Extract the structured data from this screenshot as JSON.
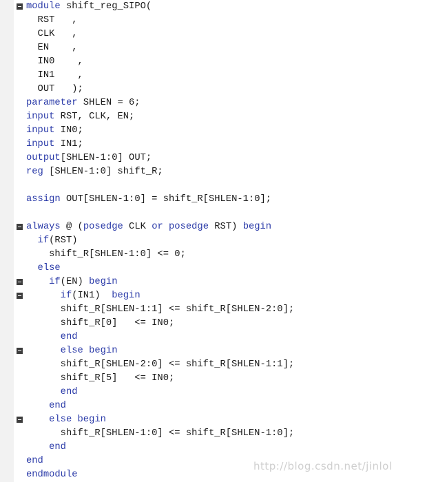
{
  "lines": [
    {
      "indent": 0,
      "segments": [
        {
          "text": "module",
          "kw": true
        },
        {
          "text": " shift_reg_SIPO("
        }
      ],
      "fold": true
    },
    {
      "indent": 2,
      "segments": [
        {
          "text": "RST   ,"
        }
      ]
    },
    {
      "indent": 2,
      "segments": [
        {
          "text": "CLK   ,"
        }
      ]
    },
    {
      "indent": 2,
      "segments": [
        {
          "text": "EN    ,"
        }
      ]
    },
    {
      "indent": 2,
      "segments": [
        {
          "text": "IN0    ,"
        }
      ]
    },
    {
      "indent": 2,
      "segments": [
        {
          "text": "IN1    ,"
        }
      ]
    },
    {
      "indent": 2,
      "segments": [
        {
          "text": "OUT   );"
        }
      ]
    },
    {
      "indent": 0,
      "segments": [
        {
          "text": "parameter",
          "kw": true
        },
        {
          "text": " SHLEN = 6;"
        }
      ]
    },
    {
      "indent": 0,
      "segments": [
        {
          "text": "input",
          "kw": true
        },
        {
          "text": " RST, CLK, EN;"
        }
      ]
    },
    {
      "indent": 0,
      "segments": [
        {
          "text": "input",
          "kw": true
        },
        {
          "text": " IN0;"
        }
      ]
    },
    {
      "indent": 0,
      "segments": [
        {
          "text": "input",
          "kw": true
        },
        {
          "text": " IN1;"
        }
      ]
    },
    {
      "indent": 0,
      "segments": [
        {
          "text": "output",
          "kw": true
        },
        {
          "text": "[SHLEN-1:0] OUT;"
        }
      ]
    },
    {
      "indent": 0,
      "segments": [
        {
          "text": "reg",
          "kw": true
        },
        {
          "text": " [SHLEN-1:0] shift_R;"
        }
      ]
    },
    {
      "indent": 0,
      "segments": []
    },
    {
      "indent": 0,
      "segments": [
        {
          "text": "assign",
          "kw": true
        },
        {
          "text": " OUT[SHLEN-1:0] = shift_R[SHLEN-1:0];"
        }
      ]
    },
    {
      "indent": 0,
      "segments": []
    },
    {
      "indent": 0,
      "segments": [
        {
          "text": "always",
          "kw": true
        },
        {
          "text": " @ ("
        },
        {
          "text": "posedge",
          "kw": true
        },
        {
          "text": " CLK "
        },
        {
          "text": "or",
          "kw": true
        },
        {
          "text": " "
        },
        {
          "text": "posedge",
          "kw": true
        },
        {
          "text": " RST) "
        },
        {
          "text": "begin",
          "kw": true
        }
      ],
      "fold": true
    },
    {
      "indent": 2,
      "segments": [
        {
          "text": "if",
          "kw": true
        },
        {
          "text": "(RST)"
        }
      ]
    },
    {
      "indent": 4,
      "segments": [
        {
          "text": "shift_R[SHLEN-1:0] <= 0;"
        }
      ]
    },
    {
      "indent": 2,
      "segments": [
        {
          "text": "else",
          "kw": true
        }
      ]
    },
    {
      "indent": 4,
      "segments": [
        {
          "text": "if",
          "kw": true
        },
        {
          "text": "(EN) "
        },
        {
          "text": "begin",
          "kw": true
        }
      ],
      "fold": true
    },
    {
      "indent": 6,
      "segments": [
        {
          "text": "if",
          "kw": true
        },
        {
          "text": "(IN1)  "
        },
        {
          "text": "begin",
          "kw": true
        }
      ],
      "fold": true
    },
    {
      "indent": 6,
      "segments": [
        {
          "text": "shift_R[SHLEN-1:1] <= shift_R[SHLEN-2:0];"
        }
      ]
    },
    {
      "indent": 6,
      "segments": [
        {
          "text": "shift_R[0]   <= IN0;"
        }
      ]
    },
    {
      "indent": 6,
      "segments": [
        {
          "text": "end",
          "kw": true
        }
      ]
    },
    {
      "indent": 6,
      "segments": [
        {
          "text": "else",
          "kw": true
        },
        {
          "text": " "
        },
        {
          "text": "begin",
          "kw": true
        }
      ],
      "fold": true
    },
    {
      "indent": 6,
      "segments": [
        {
          "text": "shift_R[SHLEN-2:0] <= shift_R[SHLEN-1:1];"
        }
      ]
    },
    {
      "indent": 6,
      "segments": [
        {
          "text": "shift_R[5]   <= IN0;"
        }
      ]
    },
    {
      "indent": 6,
      "segments": [
        {
          "text": "end",
          "kw": true
        }
      ]
    },
    {
      "indent": 4,
      "segments": [
        {
          "text": "end",
          "kw": true
        }
      ]
    },
    {
      "indent": 4,
      "segments": [
        {
          "text": "else",
          "kw": true
        },
        {
          "text": " "
        },
        {
          "text": "begin",
          "kw": true
        }
      ],
      "fold": true
    },
    {
      "indent": 6,
      "segments": [
        {
          "text": "shift_R[SHLEN-1:0] <= shift_R[SHLEN-1:0];"
        }
      ]
    },
    {
      "indent": 4,
      "segments": [
        {
          "text": "end",
          "kw": true
        }
      ]
    },
    {
      "indent": 0,
      "segments": [
        {
          "text": "end",
          "kw": true
        }
      ]
    },
    {
      "indent": 0,
      "segments": [
        {
          "text": "endmodule",
          "kw": true
        }
      ]
    }
  ],
  "watermark": "http://blog.csdn.net/jinlol",
  "colors": {
    "keyword": "#2a3aa8",
    "text": "#1a1a1a",
    "gutter": "#f2f2f2",
    "fold_marker": "#3d3d3d"
  }
}
